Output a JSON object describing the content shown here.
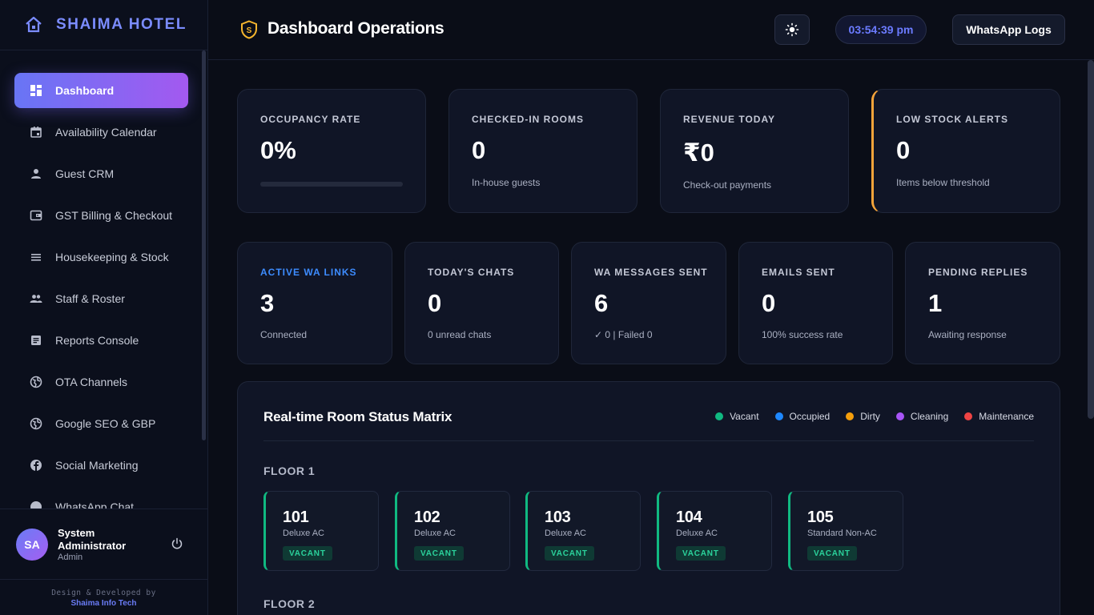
{
  "brand": {
    "name": "SHAIMA HOTEL",
    "accent": "#7b8cff"
  },
  "sidebar": {
    "items": [
      {
        "label": "Dashboard",
        "icon": "dashboard-icon",
        "active": true
      },
      {
        "label": "Availability Calendar",
        "icon": "calendar-icon"
      },
      {
        "label": "Guest CRM",
        "icon": "person-icon"
      },
      {
        "label": "GST Billing & Checkout",
        "icon": "wallet-icon"
      },
      {
        "label": "Housekeeping & Stock",
        "icon": "list-icon"
      },
      {
        "label": "Staff & Roster",
        "icon": "group-icon"
      },
      {
        "label": "Reports Console",
        "icon": "report-icon"
      },
      {
        "label": "OTA Channels",
        "icon": "globe-icon"
      },
      {
        "label": "Google SEO & GBP",
        "icon": "globe-icon"
      },
      {
        "label": "Social Marketing",
        "icon": "facebook-icon"
      },
      {
        "label": "WhatsApp Chat",
        "icon": "chat-icon"
      }
    ]
  },
  "user": {
    "initials": "SA",
    "name": "System Administrator",
    "role": "Admin"
  },
  "credit": {
    "line1": "Design & Developed by",
    "line2": "Shaima Info Tech"
  },
  "header": {
    "title": "Dashboard Operations",
    "clock": "03:54:39 pm",
    "logs_button": "WhatsApp Logs"
  },
  "stats_top": [
    {
      "label": "OCCUPANCY RATE",
      "value": "0%",
      "progress": 0
    },
    {
      "label": "CHECKED-IN ROOMS",
      "value": "0",
      "sub": "In-house guests"
    },
    {
      "label": "REVENUE TODAY",
      "value": "₹0",
      "sub": "Check-out payments"
    },
    {
      "label": "LOW STOCK ALERTS",
      "value": "0",
      "sub": "Items below threshold"
    }
  ],
  "stats_bottom": [
    {
      "label": "ACTIVE WA LINKS",
      "value": "3",
      "sub": "Connected"
    },
    {
      "label": "TODAY'S CHATS",
      "value": "0",
      "sub": "0 unread chats"
    },
    {
      "label": "WA MESSAGES SENT",
      "value": "6",
      "sub": "✓ 0 | Failed 0"
    },
    {
      "label": "EMAILS SENT",
      "value": "0",
      "sub": "100% success rate"
    },
    {
      "label": "PENDING REPLIES",
      "value": "1",
      "sub": "Awaiting response"
    }
  ],
  "matrix": {
    "title": "Real-time Room Status Matrix",
    "legend": [
      {
        "label": "Vacant",
        "color": "#10b981"
      },
      {
        "label": "Occupied",
        "color": "#1e88ff"
      },
      {
        "label": "Dirty",
        "color": "#f59e0b"
      },
      {
        "label": "Cleaning",
        "color": "#a855f7"
      },
      {
        "label": "Maintenance",
        "color": "#ef4444"
      }
    ],
    "floors": [
      {
        "label": "FLOOR 1",
        "rooms": [
          {
            "number": "101",
            "type": "Deluxe AC",
            "status": "VACANT"
          },
          {
            "number": "102",
            "type": "Deluxe AC",
            "status": "VACANT"
          },
          {
            "number": "103",
            "type": "Deluxe AC",
            "status": "VACANT"
          },
          {
            "number": "104",
            "type": "Deluxe AC",
            "status": "VACANT"
          },
          {
            "number": "105",
            "type": "Standard Non-AC",
            "status": "VACANT"
          }
        ]
      },
      {
        "label": "FLOOR 2",
        "rooms": []
      }
    ]
  }
}
